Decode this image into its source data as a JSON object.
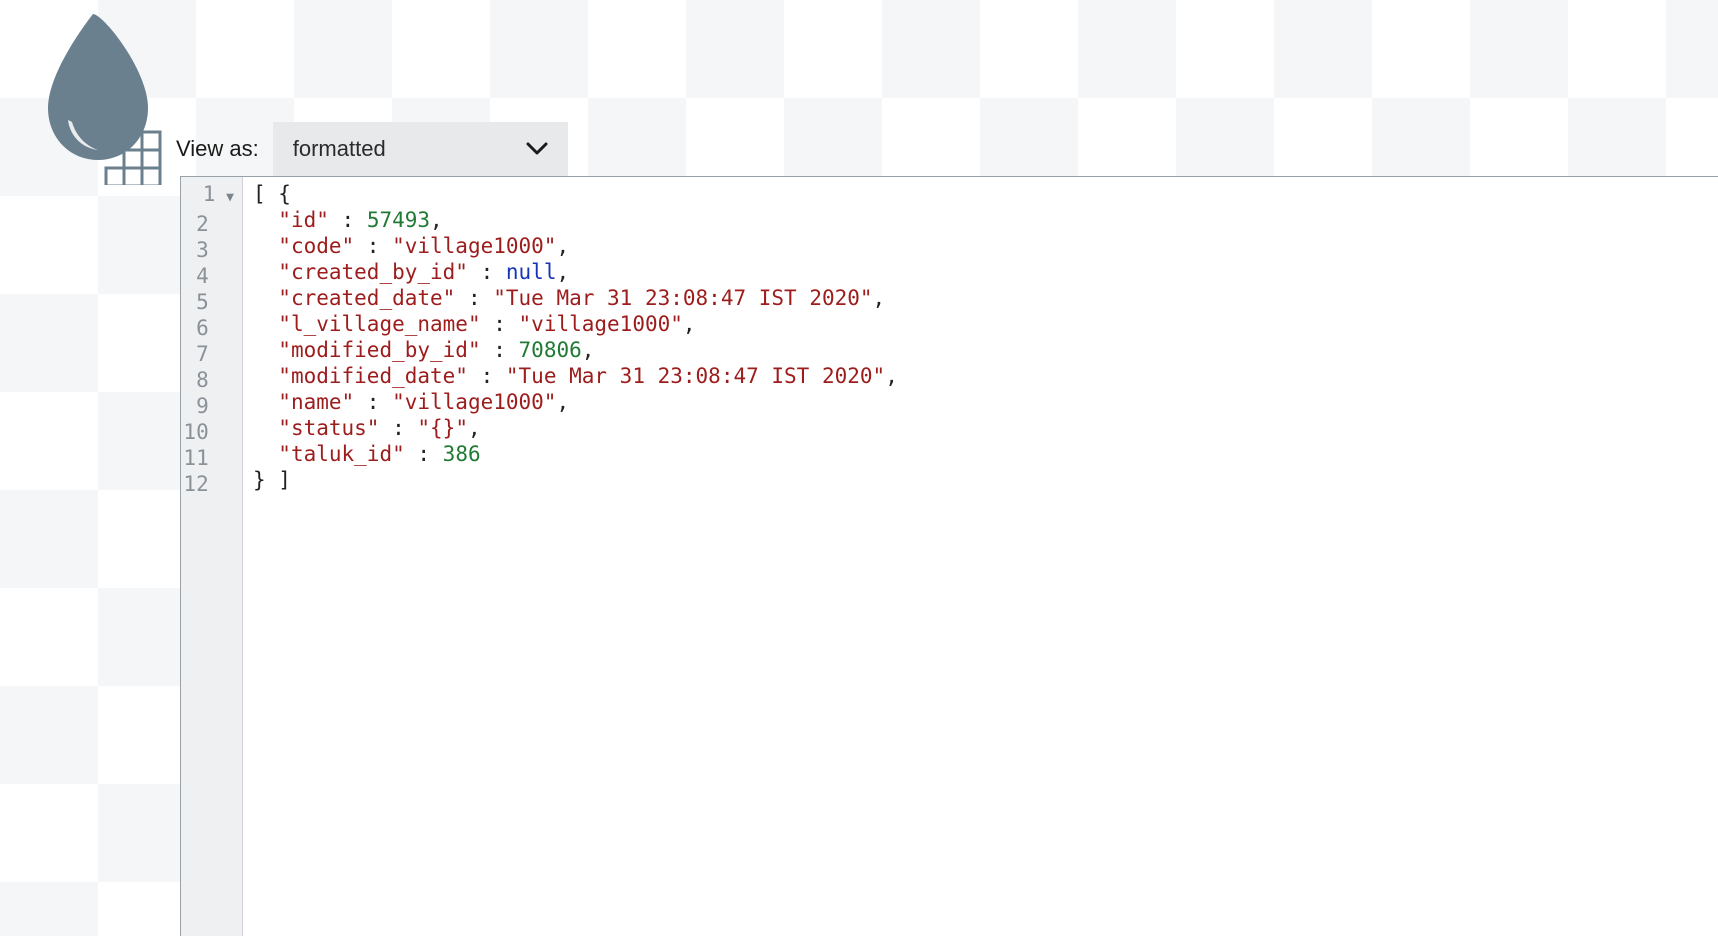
{
  "toolbar": {
    "view_as_label": "View as:",
    "select_value": "formatted"
  },
  "editor": {
    "line_count": 12,
    "fold_on_line": 1,
    "json_payload": [
      {
        "id": 57493,
        "code": "village1000",
        "created_by_id": null,
        "created_date": "Tue Mar 31 23:08:47 IST 2020",
        "l_village_name": "village1000",
        "modified_by_id": 70806,
        "modified_date": "Tue Mar 31 23:08:47 IST 2020",
        "name": "village1000",
        "status": "{}",
        "taluk_id": 386
      }
    ]
  },
  "tokens": {
    "id_key": "\"id\"",
    "id_val": "57493",
    "code_key": "\"code\"",
    "code_val": "\"village1000\"",
    "cbid_key": "\"created_by_id\"",
    "cbid_val": "null",
    "cdate_key": "\"created_date\"",
    "cdate_val": "\"Tue Mar 31 23:08:47 IST 2020\"",
    "lvn_key": "\"l_village_name\"",
    "lvn_val": "\"village1000\"",
    "mbid_key": "\"modified_by_id\"",
    "mbid_val": "70806",
    "mdate_key": "\"modified_date\"",
    "mdate_val": "\"Tue Mar 31 23:08:47 IST 2020\"",
    "name_key": "\"name\"",
    "name_val": "\"village1000\"",
    "status_key": "\"status\"",
    "status_val": "\"{}\"",
    "taluk_key": "\"taluk_id\"",
    "taluk_val": "386"
  }
}
